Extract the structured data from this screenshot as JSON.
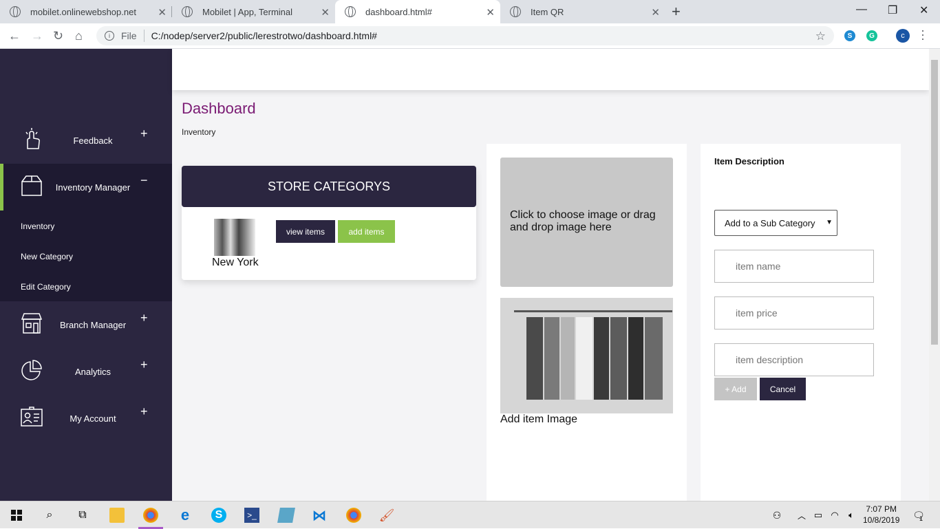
{
  "browser": {
    "tabs": [
      {
        "title": "mobilet.onlinewebshop.net"
      },
      {
        "title": "Mobilet | App, Terminal"
      },
      {
        "title": "dashboard.html#"
      },
      {
        "title": "Item QR"
      }
    ],
    "address": {
      "scheme_label": "File",
      "url": "C:/nodep/server2/public/lerestrotwo/dashboard.html#"
    },
    "profile_initial": "c"
  },
  "sidebar": {
    "items": [
      {
        "label": "Feedback",
        "toggle": "+"
      },
      {
        "label": "Inventory Manager",
        "toggle": "−"
      },
      {
        "label": "Branch Manager",
        "toggle": "+"
      },
      {
        "label": "Analytics",
        "toggle": "+"
      },
      {
        "label": "My Account",
        "toggle": "+"
      }
    ],
    "submenu": [
      "Inventory",
      "New Category",
      "Edit Category"
    ],
    "accent_color": "#8bc34a"
  },
  "main": {
    "title": "Dashboard",
    "breadcrumb": "Inventory",
    "categories": {
      "heading": "STORE CATEGORYS",
      "category_name": "New York",
      "view_label": "view items",
      "add_label": "add items"
    },
    "image_panel": {
      "dropzone_text": "Click to choose image or drag and drop image here",
      "caption": "Add item Image"
    },
    "description_panel": {
      "title": "Item Description",
      "subcategory_select": "Add to a Sub Category",
      "name_placeholder": "item name",
      "price_placeholder": "item price",
      "description_placeholder": "item description",
      "add_label": "+ Add",
      "cancel_label": "Cancel"
    }
  },
  "taskbar": {
    "time": "7:07 PM",
    "date": "10/8/2019",
    "notification_count": "1"
  }
}
